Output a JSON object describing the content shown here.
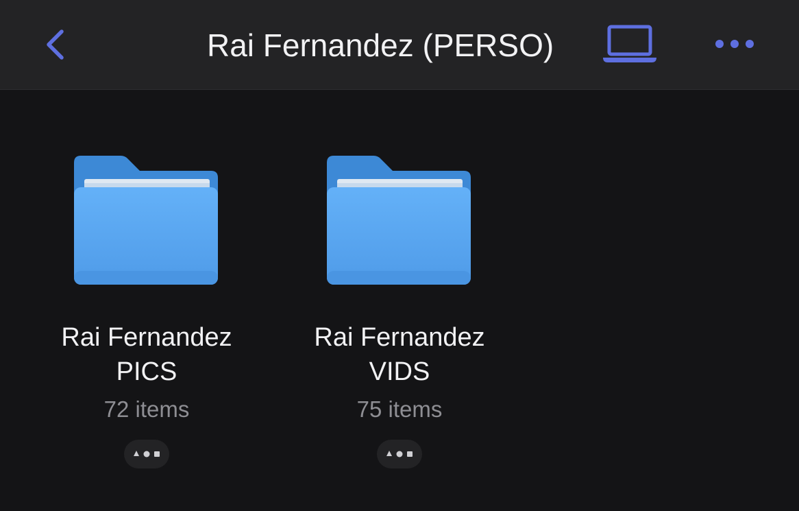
{
  "nav": {
    "title": "Rai Fernandez (PERSO)",
    "back_icon": "chevron-left-icon",
    "device_icon": "laptop-icon",
    "more_icon": "ellipsis-icon"
  },
  "colors": {
    "accent": "#5e6fe0",
    "background": "#141416",
    "nav_background": "#232325",
    "folder_blue": "#5aa8f2"
  },
  "folders": [
    {
      "name_line1": "Rai Fernandez",
      "name_line2": "PICS",
      "count": "72 items",
      "icon": "folder-icon",
      "menu_icon": "ellipsis-icon"
    },
    {
      "name_line1": "Rai Fernandez",
      "name_line2": "VIDS",
      "count": "75 items",
      "icon": "folder-icon",
      "menu_icon": "ellipsis-icon"
    }
  ]
}
